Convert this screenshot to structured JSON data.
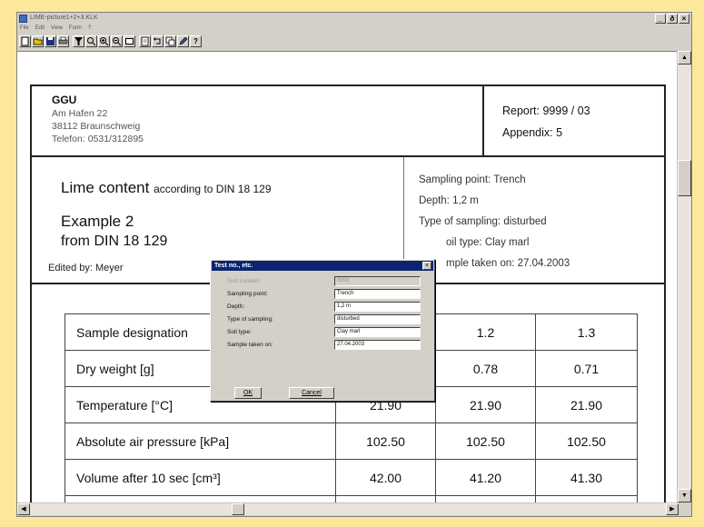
{
  "window": {
    "title": "LIME-picture1+2+3.KLK",
    "minimize": "_",
    "restore": "ð",
    "close": "×"
  },
  "menu": [
    "File",
    "Edit",
    "View",
    "Form",
    "?"
  ],
  "toolbar": {
    "icons": [
      "new-file-icon",
      "open-folder-icon",
      "save-icon",
      "print-icon",
      "filter-icon",
      "zoom-icon",
      "zoom-in-icon",
      "zoom-out-icon",
      "page-view-icon",
      "info-icon",
      "undo-icon",
      "copy-icon",
      "edit-icon",
      "help-icon"
    ],
    "help_label": "?"
  },
  "header": {
    "company_name": "GGU",
    "address_1": "Am Hafen 22",
    "address_2": "38112 Braunschweig",
    "phone": "Telefon: 0531/312895",
    "report": "Report: 9999 / 03",
    "appendix": "Appendix: 5"
  },
  "info": {
    "title_main": "Lime content",
    "title_suffix": "according to DIN 18 129",
    "example_line1": "Example 2",
    "example_line2": "from DIN 18 129",
    "edited_by": "Edited by:  Meyer",
    "sampling_point": "Sampling point:  Trench",
    "depth": "Depth:  1,2 m",
    "type_of_sampling": "Type of sampling:  disturbed",
    "soil_type": "oil type:  Clay marl",
    "sample_taken": "mple taken on:  27.04.2003"
  },
  "table": {
    "rows": [
      {
        "label": "Sample designation",
        "v1": "",
        "v2": "1.2",
        "v3": "1.3"
      },
      {
        "label": "Dry weight [g]",
        "v1": "",
        "v2": "0.78",
        "v3": "0.71"
      },
      {
        "label": "Temperature [°C]",
        "v1": "21.90",
        "v2": "21.90",
        "v3": "21.90"
      },
      {
        "label": "Absolute air pressure [kPa]",
        "v1": "102.50",
        "v2": "102.50",
        "v3": "102.50"
      },
      {
        "label": "Volume after 10 sec [cm³]",
        "v1": "42.00",
        "v2": "41.20",
        "v3": "41.30"
      }
    ]
  },
  "dialog": {
    "title": "Test no., etc.",
    "close": "×",
    "fields": [
      {
        "label": "Test number:",
        "value": "9999",
        "disabled": true
      },
      {
        "label": "Sampling point:",
        "value": "Trench",
        "disabled": false
      },
      {
        "label": "Depth:",
        "value": "1,2 m",
        "disabled": false
      },
      {
        "label": "Type of sampling:",
        "value": "disturbed",
        "disabled": false
      },
      {
        "label": "Soil type:",
        "value": "Clay marl",
        "disabled": false
      },
      {
        "label": "Sample taken on:",
        "value": "27.04.2003",
        "disabled": false
      }
    ],
    "ok_label": "OK",
    "cancel_label": "Cancel"
  }
}
